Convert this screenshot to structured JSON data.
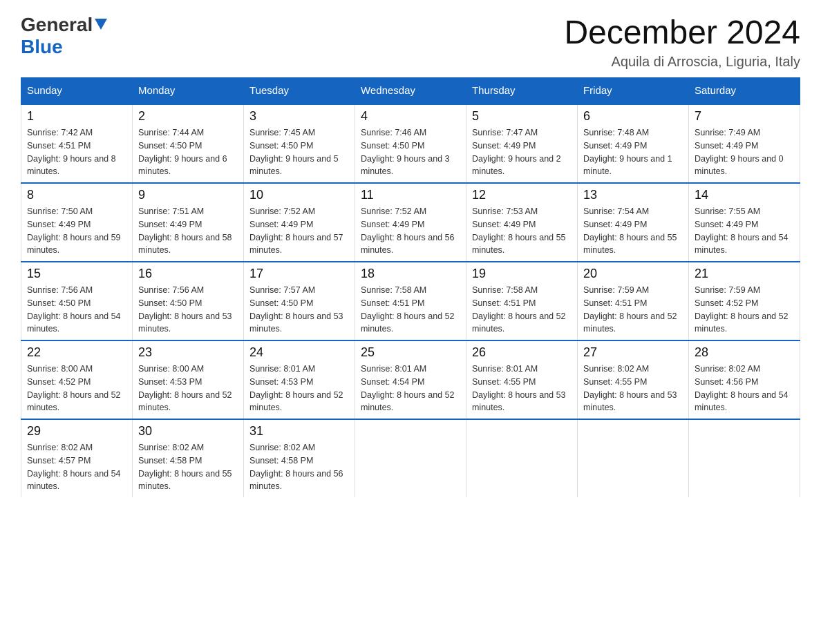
{
  "header": {
    "logo_general": "General",
    "logo_blue": "Blue",
    "month_title": "December 2024",
    "location": "Aquila di Arroscia, Liguria, Italy"
  },
  "days_of_week": [
    "Sunday",
    "Monday",
    "Tuesday",
    "Wednesday",
    "Thursday",
    "Friday",
    "Saturday"
  ],
  "weeks": [
    [
      {
        "day": "1",
        "sunrise": "7:42 AM",
        "sunset": "4:51 PM",
        "daylight": "9 hours and 8 minutes."
      },
      {
        "day": "2",
        "sunrise": "7:44 AM",
        "sunset": "4:50 PM",
        "daylight": "9 hours and 6 minutes."
      },
      {
        "day": "3",
        "sunrise": "7:45 AM",
        "sunset": "4:50 PM",
        "daylight": "9 hours and 5 minutes."
      },
      {
        "day": "4",
        "sunrise": "7:46 AM",
        "sunset": "4:50 PM",
        "daylight": "9 hours and 3 minutes."
      },
      {
        "day": "5",
        "sunrise": "7:47 AM",
        "sunset": "4:49 PM",
        "daylight": "9 hours and 2 minutes."
      },
      {
        "day": "6",
        "sunrise": "7:48 AM",
        "sunset": "4:49 PM",
        "daylight": "9 hours and 1 minute."
      },
      {
        "day": "7",
        "sunrise": "7:49 AM",
        "sunset": "4:49 PM",
        "daylight": "9 hours and 0 minutes."
      }
    ],
    [
      {
        "day": "8",
        "sunrise": "7:50 AM",
        "sunset": "4:49 PM",
        "daylight": "8 hours and 59 minutes."
      },
      {
        "day": "9",
        "sunrise": "7:51 AM",
        "sunset": "4:49 PM",
        "daylight": "8 hours and 58 minutes."
      },
      {
        "day": "10",
        "sunrise": "7:52 AM",
        "sunset": "4:49 PM",
        "daylight": "8 hours and 57 minutes."
      },
      {
        "day": "11",
        "sunrise": "7:52 AM",
        "sunset": "4:49 PM",
        "daylight": "8 hours and 56 minutes."
      },
      {
        "day": "12",
        "sunrise": "7:53 AM",
        "sunset": "4:49 PM",
        "daylight": "8 hours and 55 minutes."
      },
      {
        "day": "13",
        "sunrise": "7:54 AM",
        "sunset": "4:49 PM",
        "daylight": "8 hours and 55 minutes."
      },
      {
        "day": "14",
        "sunrise": "7:55 AM",
        "sunset": "4:49 PM",
        "daylight": "8 hours and 54 minutes."
      }
    ],
    [
      {
        "day": "15",
        "sunrise": "7:56 AM",
        "sunset": "4:50 PM",
        "daylight": "8 hours and 54 minutes."
      },
      {
        "day": "16",
        "sunrise": "7:56 AM",
        "sunset": "4:50 PM",
        "daylight": "8 hours and 53 minutes."
      },
      {
        "day": "17",
        "sunrise": "7:57 AM",
        "sunset": "4:50 PM",
        "daylight": "8 hours and 53 minutes."
      },
      {
        "day": "18",
        "sunrise": "7:58 AM",
        "sunset": "4:51 PM",
        "daylight": "8 hours and 52 minutes."
      },
      {
        "day": "19",
        "sunrise": "7:58 AM",
        "sunset": "4:51 PM",
        "daylight": "8 hours and 52 minutes."
      },
      {
        "day": "20",
        "sunrise": "7:59 AM",
        "sunset": "4:51 PM",
        "daylight": "8 hours and 52 minutes."
      },
      {
        "day": "21",
        "sunrise": "7:59 AM",
        "sunset": "4:52 PM",
        "daylight": "8 hours and 52 minutes."
      }
    ],
    [
      {
        "day": "22",
        "sunrise": "8:00 AM",
        "sunset": "4:52 PM",
        "daylight": "8 hours and 52 minutes."
      },
      {
        "day": "23",
        "sunrise": "8:00 AM",
        "sunset": "4:53 PM",
        "daylight": "8 hours and 52 minutes."
      },
      {
        "day": "24",
        "sunrise": "8:01 AM",
        "sunset": "4:53 PM",
        "daylight": "8 hours and 52 minutes."
      },
      {
        "day": "25",
        "sunrise": "8:01 AM",
        "sunset": "4:54 PM",
        "daylight": "8 hours and 52 minutes."
      },
      {
        "day": "26",
        "sunrise": "8:01 AM",
        "sunset": "4:55 PM",
        "daylight": "8 hours and 53 minutes."
      },
      {
        "day": "27",
        "sunrise": "8:02 AM",
        "sunset": "4:55 PM",
        "daylight": "8 hours and 53 minutes."
      },
      {
        "day": "28",
        "sunrise": "8:02 AM",
        "sunset": "4:56 PM",
        "daylight": "8 hours and 54 minutes."
      }
    ],
    [
      {
        "day": "29",
        "sunrise": "8:02 AM",
        "sunset": "4:57 PM",
        "daylight": "8 hours and 54 minutes."
      },
      {
        "day": "30",
        "sunrise": "8:02 AM",
        "sunset": "4:58 PM",
        "daylight": "8 hours and 55 minutes."
      },
      {
        "day": "31",
        "sunrise": "8:02 AM",
        "sunset": "4:58 PM",
        "daylight": "8 hours and 56 minutes."
      },
      null,
      null,
      null,
      null
    ]
  ]
}
